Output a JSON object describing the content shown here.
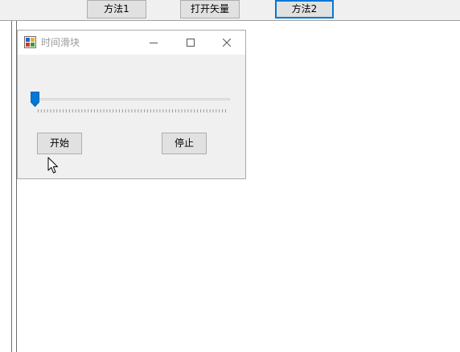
{
  "toolbar": {
    "buttons": [
      {
        "label": "方法1"
      },
      {
        "label": "打开矢量"
      },
      {
        "label": "方法2"
      }
    ]
  },
  "child_window": {
    "title": "时间滑块",
    "icon": "app-icon",
    "controls": [
      "minimize-icon",
      "maximize-icon",
      "close-icon"
    ],
    "trackbar": {
      "value_fraction": 0,
      "tick_count": 60
    },
    "start_label": "开始",
    "stop_label": "停止"
  },
  "colors": {
    "accent": "#0078d7",
    "button_face": "#e1e1e1",
    "button_border": "#adadad",
    "window_bg": "#f0f0f0",
    "title_text": "#999999"
  }
}
